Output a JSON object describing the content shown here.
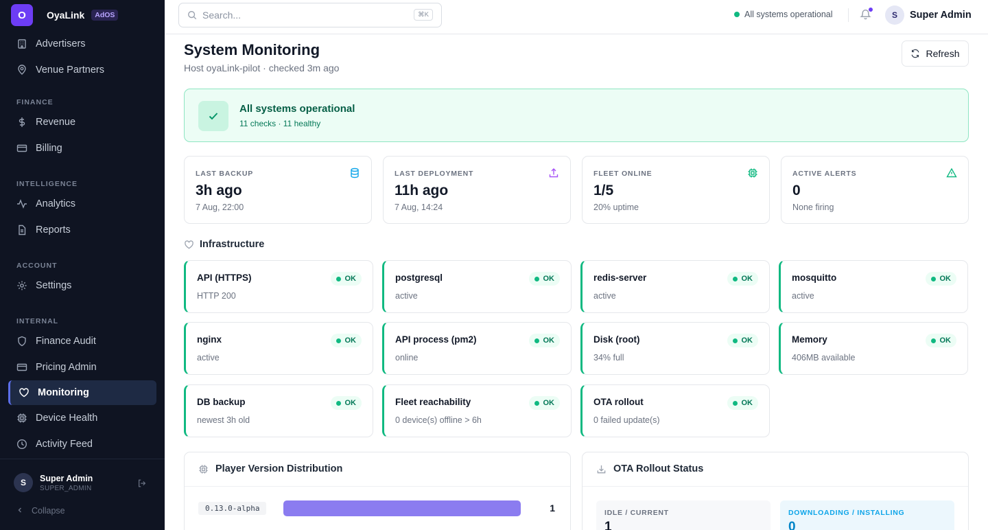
{
  "brand": {
    "logo_letter": "O",
    "name": "OyaLink",
    "badge": "AdOS"
  },
  "sidebar": {
    "top_items": [
      {
        "label": "Advertisers",
        "icon": "building-icon"
      },
      {
        "label": "Venue Partners",
        "icon": "map-pin-icon"
      }
    ],
    "sections": [
      {
        "title": "FINANCE",
        "items": [
          {
            "label": "Revenue",
            "icon": "dollar-icon"
          },
          {
            "label": "Billing",
            "icon": "credit-card-icon"
          }
        ]
      },
      {
        "title": "INTELLIGENCE",
        "items": [
          {
            "label": "Analytics",
            "icon": "activity-icon"
          },
          {
            "label": "Reports",
            "icon": "file-text-icon"
          }
        ]
      },
      {
        "title": "ACCOUNT",
        "items": [
          {
            "label": "Settings",
            "icon": "gear-icon"
          }
        ]
      },
      {
        "title": "INTERNAL",
        "items": [
          {
            "label": "Finance Audit",
            "icon": "shield-icon"
          },
          {
            "label": "Pricing Admin",
            "icon": "credit-card-icon"
          },
          {
            "label": "Monitoring",
            "icon": "heart-icon",
            "active": true
          },
          {
            "label": "Device Health",
            "icon": "cpu-icon"
          },
          {
            "label": "Activity Feed",
            "icon": "clock-icon"
          }
        ]
      }
    ],
    "user": {
      "initial": "S",
      "name": "Super Admin",
      "role": "SUPER_ADMIN"
    },
    "collapse_label": "Collapse"
  },
  "topbar": {
    "search_placeholder": "Search...",
    "search_shortcut": "⌘K",
    "system_status": "All systems operational",
    "user": {
      "initial": "S",
      "name": "Super Admin"
    }
  },
  "page": {
    "title": "System Monitoring",
    "subtitle": "Host oyaLink-pilot · checked 3m ago",
    "refresh_label": "Refresh"
  },
  "banner": {
    "title": "All systems operational",
    "subtitle": "11 checks · 11 healthy"
  },
  "stats": [
    {
      "label": "LAST BACKUP",
      "value": "3h ago",
      "sub": "7 Aug, 22:00",
      "icon": "database-icon",
      "color": "#0ea5e9"
    },
    {
      "label": "LAST DEPLOYMENT",
      "value": "11h ago",
      "sub": "7 Aug, 14:24",
      "icon": "upload-icon",
      "color": "#a855f7"
    },
    {
      "label": "FLEET ONLINE",
      "value": "1/5",
      "sub": "20% uptime",
      "icon": "cpu-icon",
      "color": "#10b981"
    },
    {
      "label": "ACTIVE ALERTS",
      "value": "0",
      "sub": "None firing",
      "icon": "alert-triangle-icon",
      "color": "#10b981"
    }
  ],
  "infrastructure": {
    "title": "Infrastructure",
    "status_label": "OK",
    "checks": [
      {
        "name": "API (HTTPS)",
        "detail": "HTTP 200"
      },
      {
        "name": "postgresql",
        "detail": "active"
      },
      {
        "name": "redis-server",
        "detail": "active"
      },
      {
        "name": "mosquitto",
        "detail": "active"
      },
      {
        "name": "nginx",
        "detail": "active"
      },
      {
        "name": "API process (pm2)",
        "detail": "online"
      },
      {
        "name": "Disk (root)",
        "detail": "34% full"
      },
      {
        "name": "Memory",
        "detail": "406MB available"
      },
      {
        "name": "DB backup",
        "detail": "newest 3h old"
      },
      {
        "name": "Fleet reachability",
        "detail": "0 device(s) offline > 6h"
      },
      {
        "name": "OTA rollout",
        "detail": "0 failed update(s)"
      }
    ]
  },
  "player_versions": {
    "title": "Player Version Distribution",
    "rows": [
      {
        "version": "0.13.0-alpha",
        "count": "1",
        "share": 1.0
      }
    ]
  },
  "ota": {
    "title": "OTA Rollout Status",
    "boxes": [
      {
        "label": "IDLE / CURRENT",
        "value": "1"
      },
      {
        "label": "DOWNLOADING / INSTALLING",
        "value": "0"
      }
    ]
  },
  "colors": {
    "accent": "#6d3df5",
    "ok": "#10b981",
    "sidebar_bg": "#0f1422"
  }
}
